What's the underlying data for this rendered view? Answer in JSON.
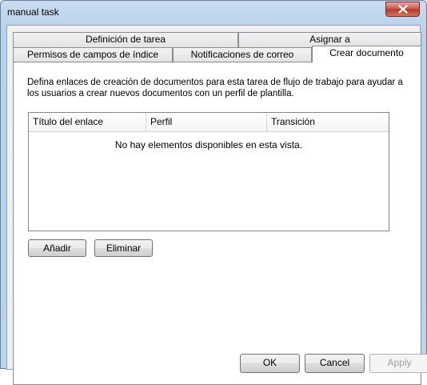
{
  "window": {
    "title": "manual task"
  },
  "tabs": {
    "row_top": [
      {
        "label": "Definición de tarea"
      },
      {
        "label": "Asignar a"
      }
    ],
    "row_bottom": [
      {
        "label": "Permisos de campos de índice"
      },
      {
        "label": "Notificaciones de correo"
      },
      {
        "label": "Crear documento"
      }
    ]
  },
  "panel": {
    "description": "Defina enlaces de creación de documentos para esta tarea de flujo de trabajo para ayudar a los usuarios a crear nuevos documentos con un perfil de plantilla.",
    "list": {
      "columns": [
        "Título del enlace",
        "Perfil",
        "Transición"
      ],
      "empty_message": "No hay elementos disponibles en esta vista."
    },
    "add_label": "Añadir",
    "delete_label": "Eliminar"
  },
  "footer": {
    "ok_label": "OK",
    "cancel_label": "Cancel",
    "apply_label": "Apply"
  }
}
